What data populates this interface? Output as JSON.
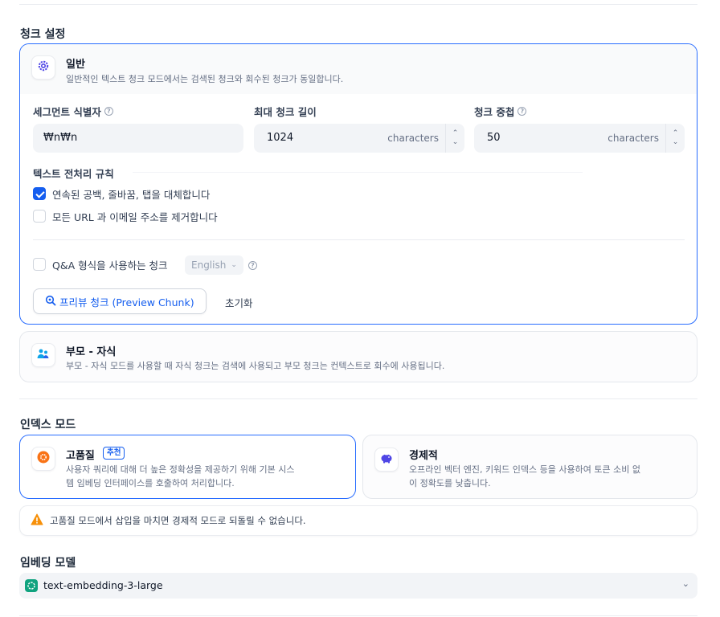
{
  "chunk_settings": {
    "title": "청크 설정",
    "general": {
      "title": "일반",
      "description": "일반적인 텍스트 청크 모드에서는 검색된 청크와 회수된 청크가 동일합니다.",
      "segment_id_label": "세그먼트 식별자",
      "segment_id_value": "₩n₩n",
      "max_length_label": "최대 청크 길이",
      "max_length_value": "1024",
      "overlap_label": "청크 중첩",
      "overlap_value": "50",
      "unit": "characters",
      "preprocess_title": "텍스트 전처리 규칙",
      "rule_whitespace": "연속된 공백, 줄바꿈, 탭을 대체합니다",
      "rule_whitespace_checked": true,
      "rule_urls": "모든 URL 과 이메일 주소를 제거합니다",
      "rule_urls_checked": false,
      "qa_label": "Q&A 형식을 사용하는 청크",
      "qa_language": "English",
      "preview_button": "프리뷰 청크 (Preview Chunk)",
      "reset_button": "초기화"
    },
    "parent_child": {
      "title": "부모 - 자식",
      "description": "부모 - 자식 모드를 사용할 때 자식 청크는 검색에 사용되고 부모 청크는 컨텍스트로 회수에 사용됩니다."
    }
  },
  "index_mode": {
    "title": "인덱스 모드",
    "high_quality": {
      "title": "고품질",
      "badge": "추천",
      "description_line1": "사용자 쿼리에 대해 더 높은 정확성을 제공하기 위해 기본 시스",
      "description_line2": "템 임베딩 인터페이스를 호출하여 처리합니다."
    },
    "economical": {
      "title": "경제적",
      "description_line1": "오프라인 벡터 엔진, 키워드 인덱스 등을 사용하여 토큰 소비 없",
      "description_line2": "이 정확도를 낮춥니다."
    },
    "warning": "고품질 모드에서 삽입을 마치면 경제적 모드로 되돌릴 수 없습니다."
  },
  "embedding": {
    "title": "임베딩 모델",
    "model": "text-embedding-3-large"
  },
  "colors": {
    "accent": "#155eef",
    "selected_border": "#296dff",
    "warning": "#f79009",
    "openai_green": "#10a37f",
    "high_quality_orange": "#f97316",
    "economical_purple": "#4f46e5"
  }
}
